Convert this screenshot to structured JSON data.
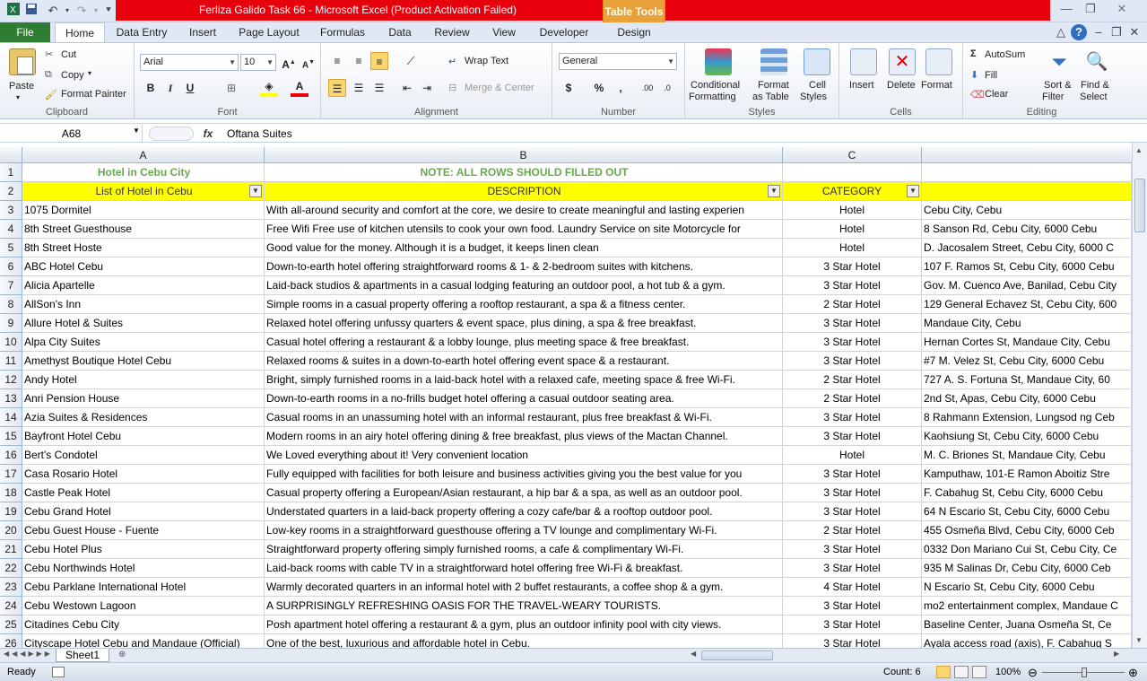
{
  "window": {
    "title": "Ferliza Galido Task 66  -  Microsoft Excel (Product Activation Failed)",
    "context_tab": "Table Tools",
    "title_color": "#e8000d",
    "context_color": "#e9a23a"
  },
  "tabs": {
    "file": "File",
    "items": [
      "Home",
      "Data Entry",
      "Insert",
      "Page Layout",
      "Formulas",
      "Data",
      "Review",
      "View",
      "Developer",
      "Design"
    ]
  },
  "ribbon": {
    "clipboard": {
      "paste": "Paste",
      "cut": "Cut",
      "copy": "Copy",
      "format_painter": "Format Painter",
      "label": "Clipboard"
    },
    "font": {
      "name": "Arial",
      "size": "10",
      "label": "Font"
    },
    "alignment": {
      "wrap_text": "Wrap Text",
      "merge_center": "Merge & Center",
      "label": "Alignment"
    },
    "number": {
      "format": "General",
      "label": "Number"
    },
    "styles": {
      "conditional": "Conditional",
      "formatting": "Formatting",
      "format": "Format",
      "as_table": "as Table",
      "cell": "Cell",
      "styles": "Styles",
      "label": "Styles"
    },
    "cells": {
      "insert": "Insert",
      "delete": "Delete",
      "format": "Format",
      "label": "Cells"
    },
    "editing": {
      "autosum": "AutoSum",
      "fill": "Fill",
      "clear": "Clear",
      "sort": "Sort &",
      "filter": "Filter",
      "find": "Find &",
      "select": "Select",
      "label": "Editing"
    }
  },
  "formula_bar": {
    "name_box": "A68",
    "fx": "fx",
    "value": "Oftana Suites"
  },
  "columns": [
    "A",
    "B",
    "C"
  ],
  "title_row": {
    "num": "1",
    "a": "Hotel in  Cebu City",
    "b": "NOTE: ALL ROWS SHOULD FILLED  OUT"
  },
  "header_row": {
    "num": "2",
    "a": "List of Hotel in  Cebu",
    "b": "DESCRIPTION",
    "c": "CATEGORY"
  },
  "rows": [
    {
      "num": "3",
      "a": "1075 Dormitel",
      "b": "With all-around security and comfort at the core, we desire to create meaningful and lasting experien",
      "c": "Hotel",
      "d": "Cebu City, Cebu"
    },
    {
      "num": "4",
      "a": "8th Street Guesthouse",
      "b": "Free Wifi Free use of kitchen utensils to cook your own food. Laundry Service on site Motorcycle for",
      "c": "Hotel",
      "d": "8 Sanson Rd, Cebu City, 6000 Cebu"
    },
    {
      "num": "5",
      "a": "8th Street Hoste",
      "b": "Good value for the money. Although it is a budget, it keeps linen clean",
      "c": "Hotel",
      "d": "D. Jacosalem Street, Cebu City, 6000 C"
    },
    {
      "num": "6",
      "a": "ABC Hotel Cebu",
      "b": "Down-to-earth hotel offering straightforward rooms & 1- & 2-bedroom suites with kitchens.",
      "c": "3 Star Hotel",
      "d": "107 F. Ramos St, Cebu City, 6000 Cebu"
    },
    {
      "num": "7",
      "a": "Alicia Apartelle",
      "b": "Laid-back studios & apartments in a casual lodging featuring an outdoor pool, a hot tub & a gym.",
      "c": "3 Star Hotel",
      "d": "Gov. M. Cuenco Ave, Banilad, Cebu City"
    },
    {
      "num": "8",
      "a": "AllSon's Inn",
      "b": "Simple rooms in a casual property offering a rooftop restaurant, a spa & a fitness center.",
      "c": "2 Star Hotel",
      "d": "129 General Echavez St, Cebu City, 600"
    },
    {
      "num": "9",
      "a": "Allure Hotel & Suites",
      "b": "Relaxed hotel offering unfussy quarters & event space, plus dining, a spa & free breakfast.",
      "c": "3 Star Hotel",
      "d": "Mandaue City, Cebu"
    },
    {
      "num": "10",
      "a": "Alpa City Suites",
      "b": "Casual hotel offering a restaurant & a lobby lounge, plus meeting space & free breakfast.",
      "c": "3 Star Hotel",
      "d": "Hernan Cortes St, Mandaue City, Cebu"
    },
    {
      "num": "11",
      "a": "Amethyst Boutique Hotel Cebu",
      "b": "Relaxed rooms & suites in a down-to-earth hotel offering event space & a restaurant.",
      "c": "3 Star Hotel",
      "d": "#7 M. Velez St, Cebu City, 6000 Cebu"
    },
    {
      "num": "12",
      "a": "Andy Hotel",
      "b": "Bright, simply furnished rooms in a laid-back hotel with a relaxed cafe, meeting space & free Wi-Fi.",
      "c": "2 Star Hotel",
      "d": "727 A. S. Fortuna St, Mandaue City, 60"
    },
    {
      "num": "13",
      "a": "Anri Pension House",
      "b": "Down-to-earth rooms in a no-frills budget hotel offering a casual outdoor seating area.",
      "c": "2 Star Hotel",
      "d": "2nd St, Apas, Cebu City, 6000 Cebu"
    },
    {
      "num": "14",
      "a": "Azia Suites & Residences",
      "b": "Casual rooms in an unassuming hotel with an informal restaurant, plus free breakfast & Wi-Fi.",
      "c": "3 Star Hotel",
      "d": "8 Rahmann Extension, Lungsod ng Ceb"
    },
    {
      "num": "15",
      "a": "Bayfront Hotel Cebu",
      "b": "Modern rooms in an airy hotel offering dining & free breakfast, plus views of the Mactan Channel.",
      "c": "3 Star Hotel",
      "d": "Kaohsiung St, Cebu City, 6000 Cebu"
    },
    {
      "num": "16",
      "a": "Bert's Condotel",
      "b": "We Loved everything about it! Very convenient location",
      "c": "Hotel",
      "d": "M. C. Briones St, Mandaue City, Cebu"
    },
    {
      "num": "17",
      "a": "Casa Rosario Hotel",
      "b": "Fully equipped with facilities for both leisure and business activities giving you the best value for you",
      "c": "3 Star Hotel",
      "d": "Kamputhaw, 101-E Ramon Aboitiz Stre"
    },
    {
      "num": "18",
      "a": "Castle Peak Hotel",
      "b": "Casual property offering a European/Asian restaurant, a hip bar & a spa, as well as an outdoor pool.",
      "c": "3 Star Hotel",
      "d": "F. Cabahug St, Cebu City, 6000 Cebu"
    },
    {
      "num": "19",
      "a": "Cebu Grand Hotel",
      "b": "Understated quarters in a laid-back property offering a cozy cafe/bar & a rooftop outdoor pool.",
      "c": "3 Star Hotel",
      "d": "64 N Escario St, Cebu City, 6000 Cebu"
    },
    {
      "num": "20",
      "a": "Cebu Guest House - Fuente",
      "b": "Low-key rooms in a straightforward guesthouse offering a TV lounge and complimentary Wi-Fi.",
      "c": "2 Star Hotel",
      "d": "455 Osmeña Blvd, Cebu City, 6000 Ceb"
    },
    {
      "num": "21",
      "a": "Cebu Hotel Plus",
      "b": "Straightforward property offering simply furnished rooms, a cafe & complimentary Wi-Fi.",
      "c": "3 Star Hotel",
      "d": "0332 Don Mariano Cui St, Cebu City, Ce"
    },
    {
      "num": "22",
      "a": "Cebu Northwinds Hotel",
      "b": "Laid-back rooms with cable TV in a straightforward hotel offering free Wi-Fi & breakfast.",
      "c": "3 Star Hotel",
      "d": "935 M Salinas Dr, Cebu City, 6000 Ceb"
    },
    {
      "num": "23",
      "a": "Cebu Parklane International Hotel",
      "b": "Warmly decorated quarters in an informal hotel with 2 buffet restaurants, a coffee shop & a gym.",
      "c": "4 Star Hotel",
      "d": "N Escario St, Cebu City, 6000 Cebu"
    },
    {
      "num": "24",
      "a": "Cebu Westown Lagoon",
      "b": "A SURPRISINGLY REFRESHING OASIS FOR THE TRAVEL-WEARY TOURISTS.",
      "c": "3 Star Hotel",
      "d": "mo2 entertainment complex, Mandaue C"
    },
    {
      "num": "25",
      "a": "Citadines Cebu City",
      "b": "Posh apartment hotel offering a restaurant & a gym, plus an outdoor infinity pool with city views.",
      "c": "3 Star Hotel",
      "d": "Baseline Center, Juana Osmeña St, Ce"
    },
    {
      "num": "26",
      "a": "Cityscape Hotel Cebu and Mandaue (Official)",
      "b": "One of the best, luxurious and affordable hotel in Cebu.",
      "c": "3 Star Hotel",
      "d": "Ayala access road (axis), F. Cabahug S"
    }
  ],
  "sheet": {
    "tab": "Sheet1"
  },
  "status": {
    "ready": "Ready",
    "count": "Count: 6",
    "zoom": "100%"
  },
  "icons": [
    "save-icon",
    "undo-icon",
    "redo-icon",
    "paste-icon",
    "cut-icon",
    "copy-icon",
    "format-painter-icon",
    "filter-dropdown-icon",
    "autosum-icon",
    "sort-filter-icon",
    "find-select-icon",
    "help-icon"
  ]
}
